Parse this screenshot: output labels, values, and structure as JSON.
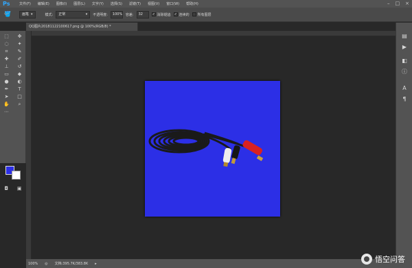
{
  "app": {
    "logo": "Ps"
  },
  "menu": [
    "文件(F)",
    "编辑(E)",
    "图像(I)",
    "图层(L)",
    "文字(Y)",
    "选择(S)",
    "滤镜(T)",
    "视图(V)",
    "窗口(W)",
    "帮助(H)"
  ],
  "options": {
    "brush_mode": "画笔",
    "mode_label": "模式:",
    "mode_value": "正常",
    "opacity_label": "不透明度:",
    "opacity_value": "100%",
    "tolerance_label": "容差:",
    "tolerance_value": "32",
    "antialias_label": "消除锯齿",
    "contiguous_label": "连续的",
    "all_layers_label": "所有图层"
  },
  "document": {
    "tab_title": "QQ图片20181122100617.png @ 100%(RGB/8) *",
    "bg_color": "#2c2fe6"
  },
  "status": {
    "zoom": "100%",
    "doc_info": "文档:395.7K/383.8K"
  },
  "colors": {
    "foreground": "#2c2fe6",
    "background": "#ffffff"
  },
  "watermark": "悟空问答"
}
